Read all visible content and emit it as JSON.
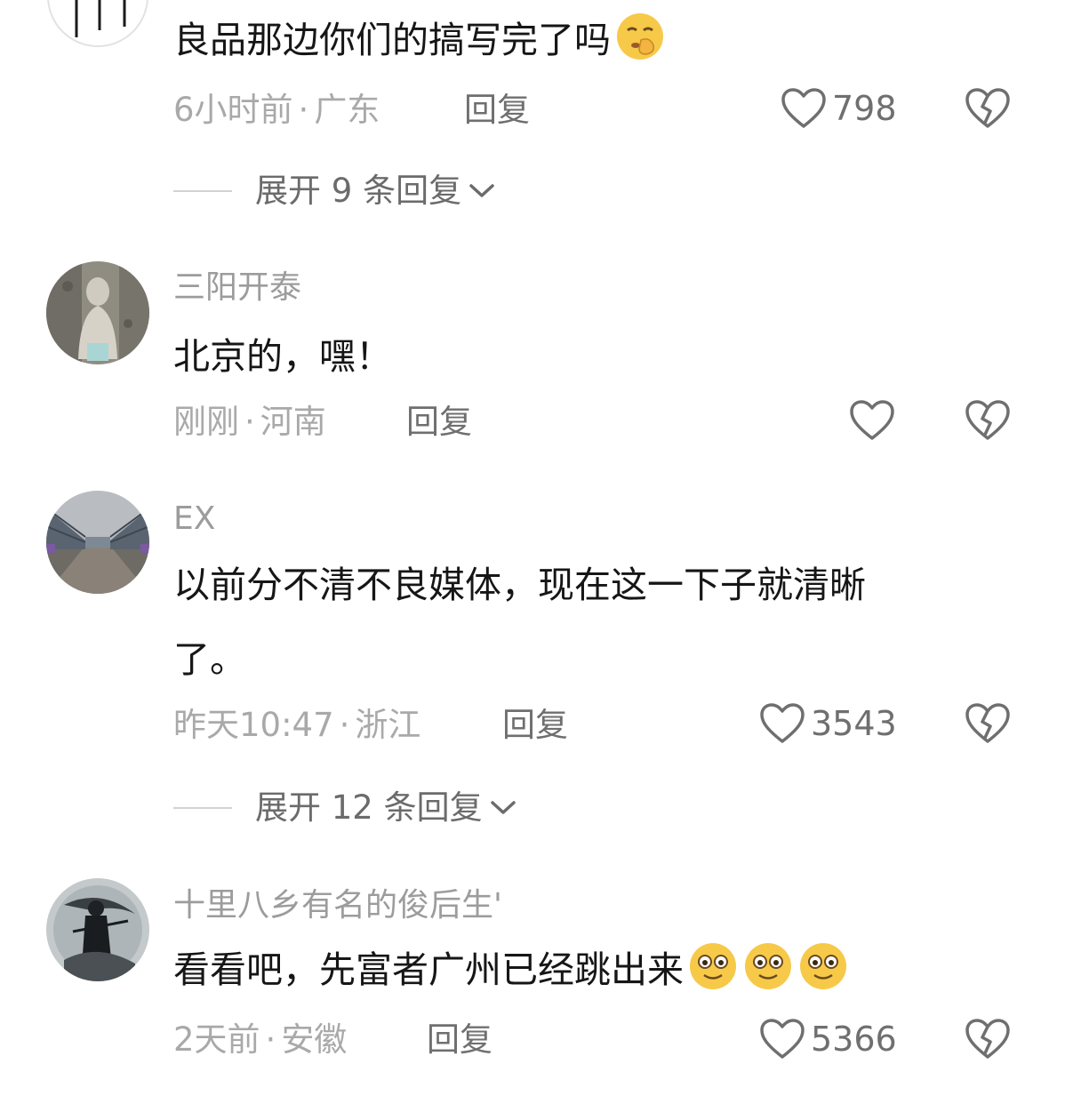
{
  "comments": [
    {
      "username": "",
      "text_lines": [
        "良品那边你们的搞写完了吗"
      ],
      "emoji": [
        "shushing-face-emoji"
      ],
      "time": "6小时前",
      "location": "广东",
      "reply_label": "回复",
      "likes": "798"
    },
    {
      "username": "三阳开泰",
      "text_lines": [
        "北京的，嘿！"
      ],
      "emoji": [],
      "time": "刚刚",
      "location": "河南",
      "reply_label": "回复",
      "likes": ""
    },
    {
      "username": "EX",
      "text_lines": [
        "以前分不清不良媒体，现在这一下子就清晰",
        "了。"
      ],
      "emoji": [],
      "time": "昨天10:47",
      "location": "浙江",
      "reply_label": "回复",
      "likes": "3543"
    },
    {
      "username": "十里八乡有名的俊后生'",
      "text_lines": [
        "看看吧，先富者广州已经跳出来"
      ],
      "emoji": [
        "smiling-face-emoji",
        "smiling-face-emoji",
        "smiling-face-emoji"
      ],
      "time": "2天前",
      "location": "安徽",
      "reply_label": "回复",
      "likes": "5366"
    }
  ],
  "expanders": [
    {
      "label": "展开 9 条回复"
    },
    {
      "label": "展开 12 条回复"
    }
  ],
  "separator": "·",
  "icons": {
    "like": "heart-outline-icon",
    "dislike": "broken-heart-icon",
    "expand": "chevron-down-icon"
  },
  "colors": {
    "text": "#161616",
    "muted": "#a9a9a9",
    "action": "#6f6f6f",
    "emoji_yellow": "#f7c948"
  }
}
